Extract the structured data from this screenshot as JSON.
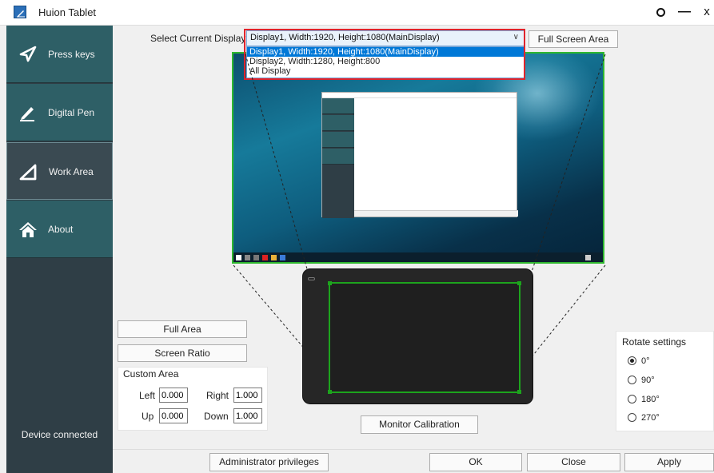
{
  "window": {
    "title": "Huion Tablet",
    "controls": {
      "settings": "settings-icon",
      "minimize": "—",
      "close": "x"
    }
  },
  "sidebar": {
    "items": [
      {
        "label": "Press keys",
        "icon": "send-arrow-icon"
      },
      {
        "label": "Digital Pen",
        "icon": "pen-icon"
      },
      {
        "label": "Work Area",
        "icon": "triangle-ruler-icon",
        "active": true
      },
      {
        "label": "About",
        "icon": "home-icon"
      }
    ],
    "status": "Device connected"
  },
  "display": {
    "label": "Select Current Display",
    "selected": "Display1, Width:1920, Height:1080(MainDisplay)",
    "options": [
      "Display1, Width:1920, Height:1080(MainDisplay)",
      "Display2, Width:1280, Height:800",
      "All Display"
    ],
    "full_screen_label": "Full Screen Area"
  },
  "area_controls": {
    "full_area_label": "Full Area",
    "screen_ratio_label": "Screen Ratio",
    "custom_area_title": "Custom Area",
    "left_label": "Left",
    "left_value": "0.000",
    "right_label": "Right",
    "right_value": "1.000",
    "up_label": "Up",
    "up_value": "0.000",
    "down_label": "Down",
    "down_value": "1.000"
  },
  "monitor_calibration_label": "Monitor Calibration",
  "rotate": {
    "title": "Rotate settings",
    "options": [
      "0°",
      "90°",
      "180°",
      "270°"
    ],
    "selected": "0°"
  },
  "footer": {
    "admin_label": "Administrator privileges",
    "ok_label": "OK",
    "close_label": "Close",
    "apply_label": "Apply"
  },
  "colors": {
    "sidebar_bg": "#2f3e46",
    "nav_item_bg": "#2e5f66",
    "mapping_green": "#1da41d",
    "highlight_red": "#e0242c",
    "selection_blue": "#0078d7"
  }
}
